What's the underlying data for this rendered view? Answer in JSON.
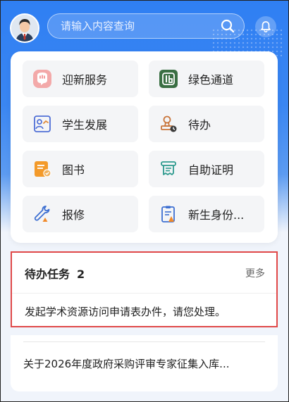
{
  "header": {
    "search_placeholder": "请输入内容查询"
  },
  "services": [
    {
      "label": "迎新服务",
      "icon": "welcome-icon"
    },
    {
      "label": "绿色通道",
      "icon": "green-channel-icon"
    },
    {
      "label": "学生发展",
      "icon": "student-development-icon"
    },
    {
      "label": "待办",
      "icon": "todo-stamp-icon"
    },
    {
      "label": "图书",
      "icon": "book-icon"
    },
    {
      "label": "自助证明",
      "icon": "self-certificate-icon"
    },
    {
      "label": "报修",
      "icon": "repair-wrench-icon"
    },
    {
      "label": "新生身份...",
      "icon": "new-student-identity-icon"
    }
  ],
  "todo": {
    "title": "待办任务",
    "count": "2",
    "more": "更多",
    "message": "发起学术资源访问申请表办件，请您处理。"
  },
  "notice": {
    "text": "关于2026年度政府采购评审专家征集入库..."
  },
  "colors": {
    "primary_blue": "#2f7ff3",
    "highlight_border": "#e04848"
  }
}
